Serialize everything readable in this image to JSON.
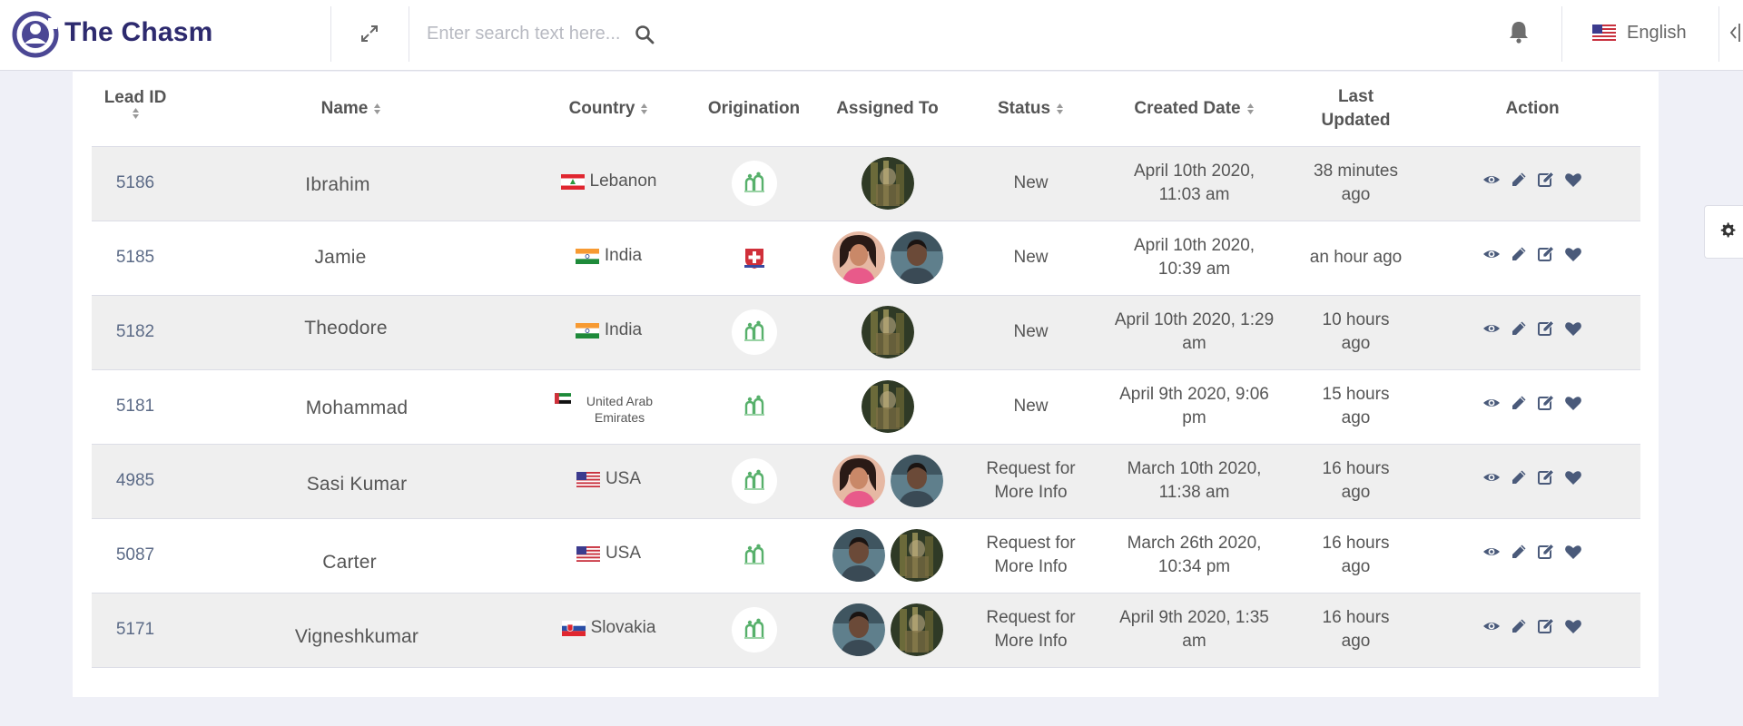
{
  "brand": {
    "name": "The Chasm"
  },
  "search": {
    "placeholder": "Enter search text here..."
  },
  "language": {
    "label": "English"
  },
  "table": {
    "columns": [
      {
        "label": "Lead ID",
        "sortable": true
      },
      {
        "label": "Name",
        "sortable": true
      },
      {
        "label": "Country",
        "sortable": true
      },
      {
        "label": "Origination",
        "sortable": false
      },
      {
        "label": "Assigned To",
        "sortable": false
      },
      {
        "label": "Status",
        "sortable": true
      },
      {
        "label": "Created Date",
        "sortable": true
      },
      {
        "label": "Last Updated",
        "sortable": false
      },
      {
        "label": "Action",
        "sortable": false
      }
    ],
    "rows": [
      {
        "id": "5186",
        "name": "Ibrahim",
        "country": "Lebanon",
        "country_flag": "lebanon-flag",
        "origination": "web-badge",
        "assigned": [
          "assignee-a"
        ],
        "status": "New",
        "created": "April 10th 2020, 11:03 am",
        "updated": "38 minutes ago"
      },
      {
        "id": "5185",
        "name": "Jamie",
        "country": "India",
        "country_flag": "india-flag",
        "origination": "swiss-badge",
        "assigned": [
          "assignee-b",
          "assignee-c"
        ],
        "status": "New",
        "created": "April 10th 2020, 10:39 am",
        "updated": "an hour ago"
      },
      {
        "id": "5182",
        "name": "Theodore",
        "country": "India",
        "country_flag": "india-flag",
        "origination": "web-badge",
        "assigned": [
          "assignee-a"
        ],
        "status": "New",
        "created": "April 10th 2020, 1:29 am",
        "updated": "10 hours ago"
      },
      {
        "id": "5181",
        "name": "Mohammad",
        "country": "United Arab Emirates",
        "country_flag": "uae-flag",
        "origination": "web-plain",
        "assigned": [
          "assignee-a"
        ],
        "status": "New",
        "created": "April 9th 2020, 9:06 pm",
        "updated": "15 hours ago"
      },
      {
        "id": "4985",
        "name": "Sasi Kumar",
        "country": "USA",
        "country_flag": "usa-flag",
        "origination": "web-badge",
        "assigned": [
          "assignee-b",
          "assignee-c"
        ],
        "status": "Request for More Info",
        "created": "March 10th 2020, 11:38 am",
        "updated": "16 hours ago"
      },
      {
        "id": "5087",
        "name": "Carter",
        "country": "USA",
        "country_flag": "usa-flag",
        "origination": "web-plain",
        "assigned": [
          "assignee-c",
          "assignee-a"
        ],
        "status": "Request for More Info",
        "created": "March 26th 2020, 10:34 pm",
        "updated": "16 hours ago"
      },
      {
        "id": "5171",
        "name": "Vigneshkumar",
        "country": "Slovakia",
        "country_flag": "slovakia-flag",
        "origination": "web-badge",
        "assigned": [
          "assignee-c",
          "assignee-a"
        ],
        "status": "Request for More Info",
        "created": "April 9th 2020, 1:35 am",
        "updated": "16 hours ago"
      }
    ],
    "actions": [
      "view-icon",
      "pencil-icon",
      "edit-icon",
      "heart-icon"
    ]
  },
  "colors": {
    "brand": "#2d2a6e",
    "logo": "#4b4794",
    "accent_green": "#57b06b",
    "action_icon": "#4a5a7a",
    "row_alt": "#efefef"
  }
}
